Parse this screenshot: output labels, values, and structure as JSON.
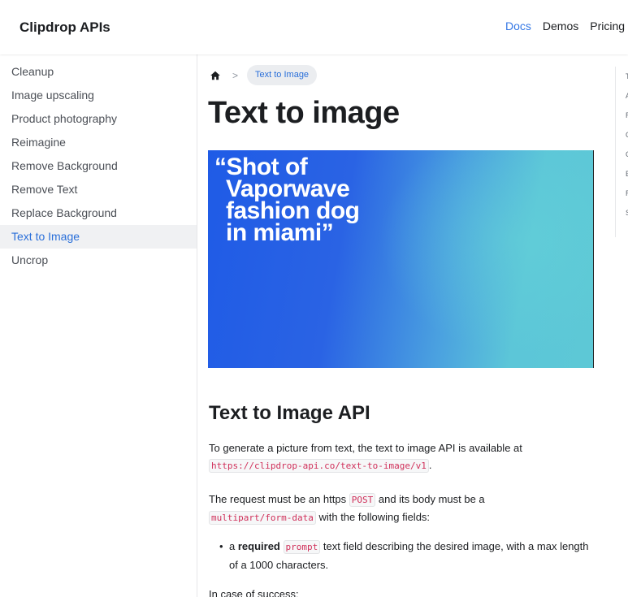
{
  "navbar": {
    "brand": "Clipdrop APIs",
    "links": [
      "Docs",
      "Demos",
      "Pricing"
    ]
  },
  "sidebar": {
    "items": [
      {
        "label": "Cleanup"
      },
      {
        "label": "Image upscaling"
      },
      {
        "label": "Product photography"
      },
      {
        "label": "Reimagine"
      },
      {
        "label": "Remove Background"
      },
      {
        "label": "Remove Text"
      },
      {
        "label": "Replace Background"
      },
      {
        "label": "Text to Image"
      },
      {
        "label": "Uncrop"
      }
    ],
    "active_index": 7
  },
  "breadcrumb": {
    "home_icon": "home-icon",
    "separator": ">",
    "current": "Text to Image"
  },
  "page_title": "Text to image",
  "hero": {
    "lines": [
      "“Shot of",
      "Vaporwave",
      "fashion dog",
      "in miami”"
    ]
  },
  "toc": {
    "items": [
      "T",
      "A",
      "R",
      "C",
      "C",
      "E",
      "R",
      "S"
    ]
  },
  "section": {
    "title": "Text to Image API",
    "p1_before": "To generate a picture from text, the text to image API is available at",
    "p1_code": "https://clipdrop-api.co/text-to-image/v1",
    "p1_after": ".",
    "p2_before": "The request must be an https",
    "p2_code1": "POST",
    "p2_mid": "and its body must be a",
    "p2_code2": "multipart/form-data",
    "p2_after": "with the following fields:",
    "bullet_a": "a",
    "bullet_required": "required",
    "bullet_code": "prompt",
    "bullet_rest": "text field describing the desired image, with a max length of a 1000 characters.",
    "p3": "In case of success:"
  }
}
